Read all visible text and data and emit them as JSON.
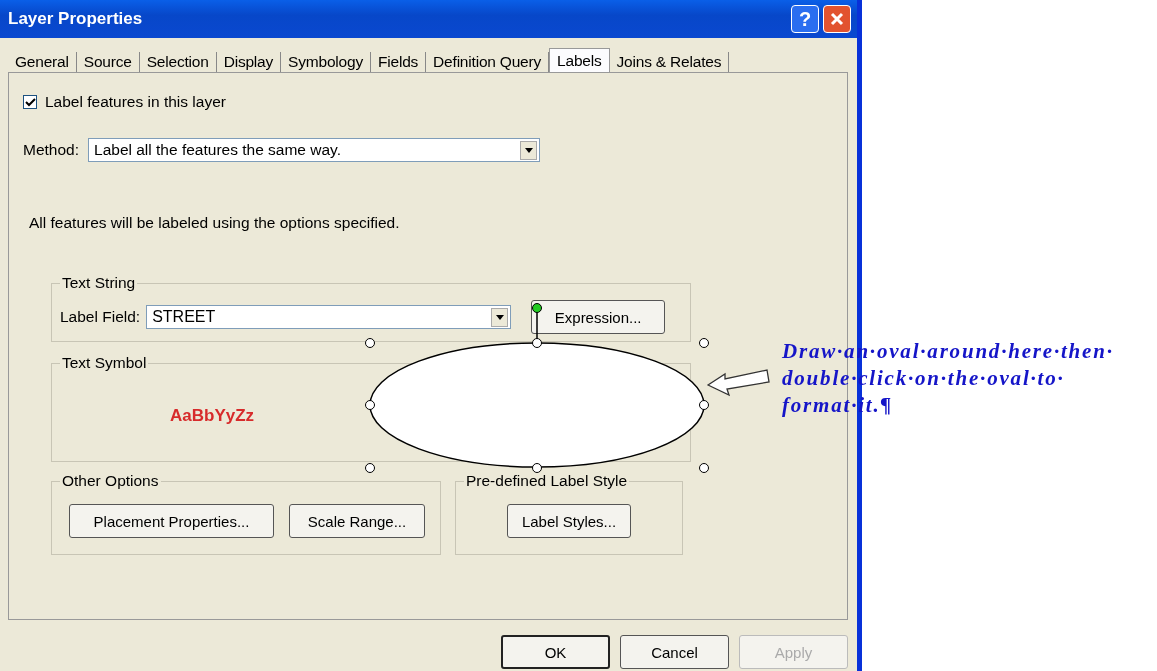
{
  "window": {
    "title": "Layer Properties",
    "help": "?"
  },
  "tabs": [
    {
      "label": "General",
      "selected": false
    },
    {
      "label": "Source",
      "selected": false
    },
    {
      "label": "Selection",
      "selected": false
    },
    {
      "label": "Display",
      "selected": false
    },
    {
      "label": "Symbology",
      "selected": false
    },
    {
      "label": "Fields",
      "selected": false
    },
    {
      "label": "Definition Query",
      "selected": false
    },
    {
      "label": "Labels",
      "selected": true
    },
    {
      "label": "Joins & Relates",
      "selected": false
    }
  ],
  "label_features": {
    "label": "Label features in this layer",
    "checked": true
  },
  "method": {
    "label": "Method:",
    "value": "Label all the features the same way."
  },
  "info": "All features will be labeled using the options specified.",
  "text_string": {
    "legend": "Text String",
    "field_label": "Label Field:",
    "value": "STREET",
    "button": "Expression..."
  },
  "text_symbol": {
    "legend": "Text Symbol",
    "sample": "AaBbYyZz"
  },
  "other_options": {
    "legend": "Other Options",
    "buttons": [
      "Placement Properties...",
      "Scale Range..."
    ]
  },
  "predefined": {
    "legend": "Pre-defined Label Style",
    "buttons": [
      "Label Styles..."
    ]
  },
  "footer": [
    {
      "label": "OK",
      "disabled": false,
      "default": true
    },
    {
      "label": "Cancel",
      "disabled": false,
      "default": false
    },
    {
      "label": "Apply",
      "disabled": true,
      "default": false
    }
  ],
  "annotation": {
    "lines": [
      "Draw·an·oval·around·here·then·",
      "double·click·on·the·oval·to·",
      "format·it.¶"
    ]
  }
}
